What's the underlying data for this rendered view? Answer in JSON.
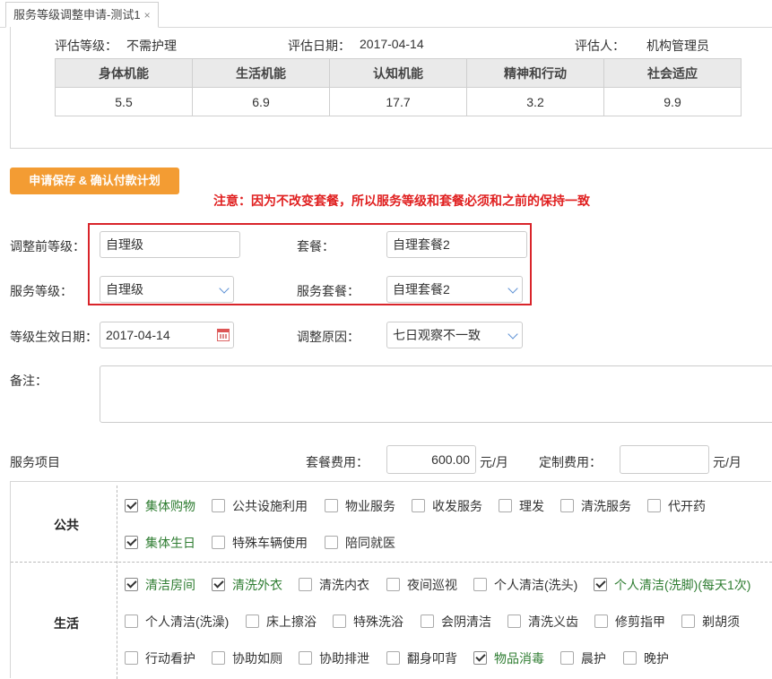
{
  "tab": {
    "title": "服务等级调整申请-测试1",
    "close": "×"
  },
  "eval": {
    "level_label": "评估等级：",
    "level_value": "不需护理",
    "date_label": "评估日期：",
    "date_value": "2017-04-14",
    "assessor_label": "评估人：",
    "assessor_value": "机构管理员",
    "headers": [
      "身体机能",
      "生活机能",
      "认知机能",
      "精神和行动",
      "社会适应"
    ],
    "scores": [
      "5.5",
      "6.9",
      "17.7",
      "3.2",
      "9.9"
    ]
  },
  "actions": {
    "save_label": "申请保存 & 确认付款计划"
  },
  "notice": "注意：因为不改变套餐，所以服务等级和套餐必须和之前的保持一致",
  "form": {
    "prev_level_label": "调整前等级：",
    "prev_level_value": "自理级",
    "package_label": "套餐：",
    "package_value": "自理套餐2",
    "service_level_label": "服务等级：",
    "service_level_value": "自理级",
    "service_package_label": "服务套餐：",
    "service_package_value": "自理套餐2",
    "effective_date_label": "等级生效日期：",
    "effective_date_value": "2017-04-14",
    "reason_label": "调整原因：",
    "reason_value": "七日观察不一致",
    "remark_label": "备注："
  },
  "fees": {
    "items_label": "服务项目",
    "package_fee_label": "套餐费用：",
    "package_fee_value": "600.00",
    "package_fee_unit": "元/月",
    "custom_fee_label": "定制费用：",
    "custom_fee_value": "",
    "custom_fee_unit": "元/月"
  },
  "services": {
    "public": {
      "label": "公共",
      "items": [
        {
          "label": "集体购物",
          "checked": true
        },
        {
          "label": "公共设施利用",
          "checked": false
        },
        {
          "label": "物业服务",
          "checked": false
        },
        {
          "label": "收发服务",
          "checked": false
        },
        {
          "label": "理发",
          "checked": false
        },
        {
          "label": "清洗服务",
          "checked": false
        },
        {
          "label": "代开药",
          "checked": false
        },
        {
          "label": "集体生日",
          "checked": true
        },
        {
          "label": "特殊车辆使用",
          "checked": false
        },
        {
          "label": "陪同就医",
          "checked": false
        }
      ]
    },
    "life": {
      "label": "生活",
      "items": [
        {
          "label": "清洁房间",
          "checked": true
        },
        {
          "label": "清洗外衣",
          "checked": true
        },
        {
          "label": "清洗内衣",
          "checked": false
        },
        {
          "label": "夜间巡视",
          "checked": false
        },
        {
          "label": "个人清洁(洗头)",
          "checked": false
        },
        {
          "label": "个人清洁(洗脚)(每天1次)",
          "checked": true
        },
        {
          "label": "个人清洁(洗澡)",
          "checked": false
        },
        {
          "label": "床上擦浴",
          "checked": false
        },
        {
          "label": "特殊洗浴",
          "checked": false
        },
        {
          "label": "会阴清洁",
          "checked": false
        },
        {
          "label": "清洗义齿",
          "checked": false
        },
        {
          "label": "修剪指甲",
          "checked": false
        },
        {
          "label": "剃胡须",
          "checked": false
        },
        {
          "label": "行动看护",
          "checked": false
        },
        {
          "label": "协助如厕",
          "checked": false
        },
        {
          "label": "协助排泄",
          "checked": false
        },
        {
          "label": "翻身叩背",
          "checked": false
        },
        {
          "label": "物品消毒",
          "checked": true
        },
        {
          "label": "晨护",
          "checked": false
        },
        {
          "label": "晚护",
          "checked": false
        }
      ]
    }
  },
  "colors": {
    "accent": "#f39c33",
    "alert": "#e02020",
    "checked_text": "#2f7d32",
    "link_blue": "#5b8fd4"
  }
}
